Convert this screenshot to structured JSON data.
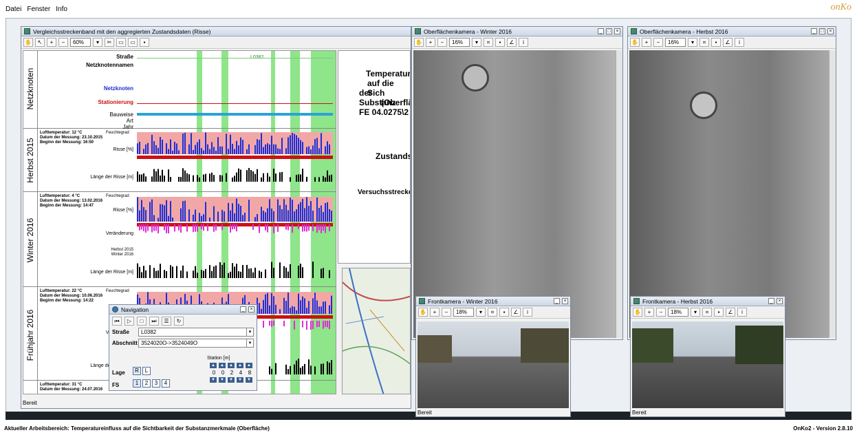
{
  "menu": {
    "items": [
      "Datei",
      "Fenster",
      "Info"
    ],
    "brand": "onKo"
  },
  "status": {
    "left": "Aktueller Arbeitsbereich: Temperatureinfluss auf die Sichtbarkeit der Substanzmerkmale (Oberfläche)",
    "right": "OnKo2 - Version 2.8.10"
  },
  "main": {
    "title": "Vergleichsstreckenband mit den aggregierten Zustandsdaten (Risse)",
    "zoom": "60%",
    "ready": "Bereit",
    "header_labels": [
      "Straße",
      "Netzknotennamen",
      "Netzknoten",
      "Stationierung",
      "Bauweise",
      "Art",
      "Jahr"
    ],
    "road_label": "L0382",
    "sections": [
      {
        "name": "Netzknoten"
      },
      {
        "name": "Herbst 2015",
        "info": [
          "Lufttemperatur: 12 °C",
          "Datum der Messung: 23.10.2015",
          "Beginn der Messung: 16:50"
        ],
        "rows": [
          "Risse [%]",
          "Länge der Risse [m]"
        ]
      },
      {
        "name": "Winter 2016",
        "info": [
          "Lufttemperatur: 4 °C",
          "Datum der Messung: 13.02.2016",
          "Beginn der Messung: 14:47"
        ],
        "rows": [
          "Risse [%]",
          "Veränderung",
          "Herbst 2015",
          "Winter 2016",
          "Länge der Risse [m]"
        ]
      },
      {
        "name": "Frühjahr 2016",
        "info": [
          "Lufttemperatur: 22 °C",
          "Datum der Messung: 10.06.2016",
          "Beginn der Messung: 14:22"
        ],
        "rows": [
          "Risse [%]",
          "Veränderung",
          "Herbst 2...",
          "Frühjahr 2...",
          "Länge der Risse [m]"
        ]
      },
      {
        "name": "",
        "info": [
          "Lufttemperatur: 31 °C",
          "Datum der Messung: 24.07.2016"
        ],
        "rows": []
      }
    ],
    "feuchtegrad": "Feuchtegrad",
    "right_text": [
      "Temperatur",
      "auf die Sich",
      "der Substanz",
      "(Oberflä",
      "FE 04.0275\\2",
      "Zustands",
      "Versuchsstrecke"
    ]
  },
  "windows": [
    {
      "id": "ok-winter",
      "title": "Oberflächenkamera - Winter 2016",
      "zoom": "16%"
    },
    {
      "id": "ok-herbst",
      "title": "Oberflächenkamera - Herbst 2016",
      "zoom": "16%"
    },
    {
      "id": "fk-winter",
      "title": "Frontkamera - Winter 2016",
      "zoom": "18%",
      "ready": "Bereit"
    },
    {
      "id": "fk-herbst",
      "title": "Frontkamera - Herbst 2016",
      "zoom": "18%",
      "ready": "Bereit"
    }
  ],
  "navigation": {
    "title": "Navigation",
    "strasse_label": "Straße",
    "strasse_value": "L0382",
    "abschnitt_label": "Abschnitt",
    "abschnitt_value": "3524020O->3524049O",
    "station_label": "Station [m]",
    "station_digits": [
      "0",
      "0",
      "2",
      "4",
      "8"
    ],
    "lage_label": "Lage",
    "lage_options": [
      "R",
      "L"
    ],
    "fs_label": "FS",
    "fs_options": [
      "1",
      "2",
      "3",
      "4"
    ]
  },
  "colors": {
    "green": "#8ee58a",
    "blue": "#1a2fd6",
    "red": "#cc1111",
    "magenta": "#e02ad6",
    "salmon": "#f2a7a7"
  }
}
